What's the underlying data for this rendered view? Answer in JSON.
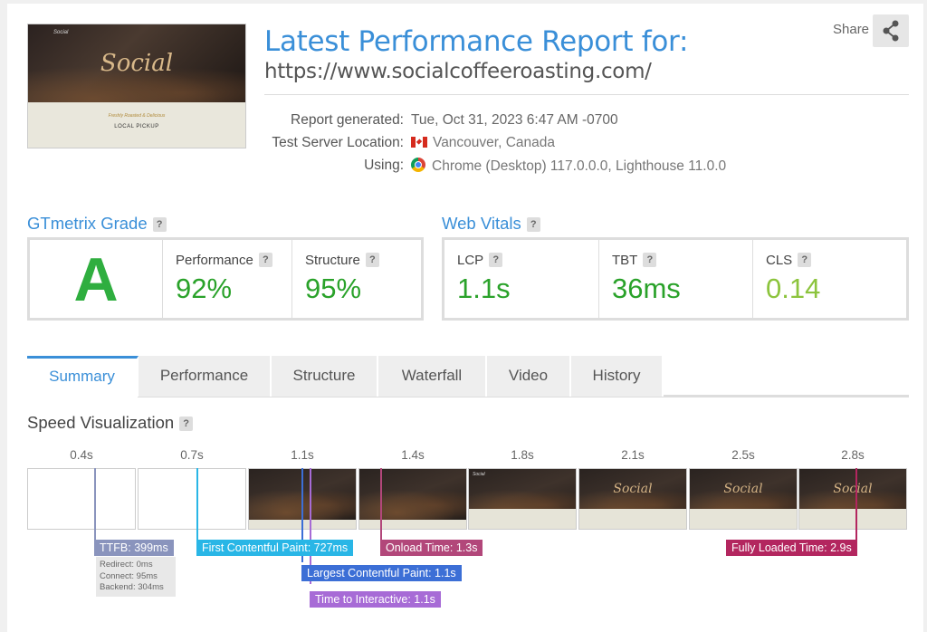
{
  "header": {
    "title": "Latest Performance Report for:",
    "url": "https://www.socialcoffeeroasting.com/",
    "share_label": "Share",
    "share_icon": "share-icon"
  },
  "thumbnail": {
    "logo": "Social",
    "mini_logo": "Social",
    "tagline": "Freshly Roasted & Delicious",
    "pickup": "LOCAL PICKUP"
  },
  "meta": {
    "generated_label": "Report generated:",
    "generated_value": "Tue, Oct 31, 2023 6:47 AM -0700",
    "location_label": "Test Server Location:",
    "location_value": "Vancouver, Canada",
    "location_icon": "canada-flag-icon",
    "using_label": "Using:",
    "using_value": "Chrome (Desktop) 117.0.0.0, Lighthouse 11.0.0",
    "using_icon": "chrome-icon"
  },
  "grade": {
    "title": "GTmetrix Grade",
    "help": "?",
    "letter": "A",
    "performance_label": "Performance",
    "performance_value": "92%",
    "structure_label": "Structure",
    "structure_value": "95%"
  },
  "vitals": {
    "title": "Web Vitals",
    "help": "?",
    "lcp_label": "LCP",
    "lcp_value": "1.1s",
    "tbt_label": "TBT",
    "tbt_value": "36ms",
    "cls_label": "CLS",
    "cls_value": "0.14"
  },
  "tabs": [
    {
      "label": "Summary",
      "active": true
    },
    {
      "label": "Performance"
    },
    {
      "label": "Structure"
    },
    {
      "label": "Waterfall"
    },
    {
      "label": "Video"
    },
    {
      "label": "History"
    }
  ],
  "speed": {
    "title": "Speed Visualization",
    "help": "?",
    "ticks": [
      "0.4s",
      "0.7s",
      "1.1s",
      "1.4s",
      "1.8s",
      "2.1s",
      "2.5s",
      "2.8s"
    ],
    "frame_logo": "Social",
    "markers": {
      "ttfb": "TTFB: 399ms",
      "fcp": "First Contentful Paint: 727ms",
      "onload": "Onload Time: 1.3s",
      "fully_loaded": "Fully Loaded Time: 2.9s",
      "lcp": "Largest Contentful Paint: 1.1s",
      "tti": "Time to Interactive: 1.1s"
    },
    "ttfb_breakdown": {
      "redirect": "Redirect: 0ms",
      "connect": "Connect: 95ms",
      "backend": "Backend: 304ms"
    }
  },
  "colors": {
    "accent": "#3a8fd8",
    "grade_green": "#2fae3f",
    "score_green": "#2aa22a",
    "cls_green": "#8cc43d",
    "ttfb": "#8a94bd",
    "fcp": "#29b6e6",
    "lcp": "#3c6fd6",
    "tti": "#a76bd6",
    "onload": "#b2477a",
    "fully_loaded": "#b3265f"
  }
}
